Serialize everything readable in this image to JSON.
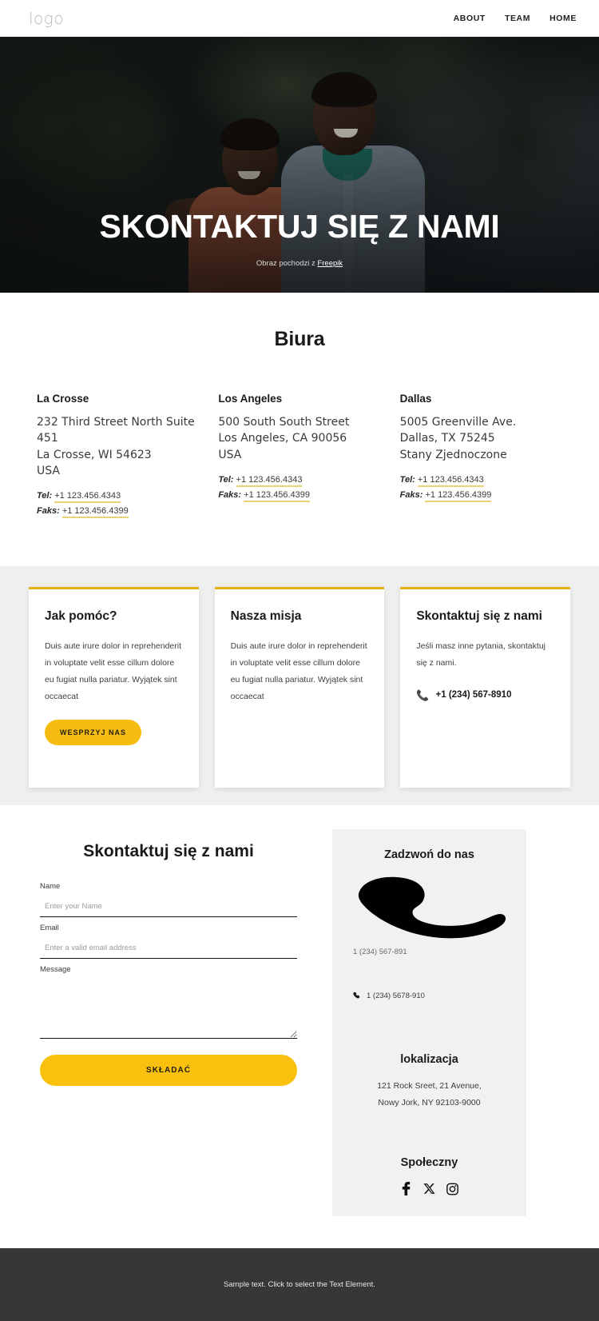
{
  "header": {
    "logo": "logo",
    "nav": [
      {
        "label": "ABOUT"
      },
      {
        "label": "TEAM"
      },
      {
        "label": "HOME"
      }
    ]
  },
  "hero": {
    "title": "SKONTAKTUJ SIĘ Z NAMI",
    "credit_prefix": "Obraz pochodzi z ",
    "credit_link": "Freepik"
  },
  "offices": {
    "heading": "Biura",
    "tel_label": "Tel:",
    "fax_label": "Faks:",
    "items": [
      {
        "city": "La Crosse",
        "address": "232 Third Street North Suite 451\nLa Crosse, WI 54623\nUSA",
        "tel": "+1 123.456.4343",
        "fax": "+1 123.456.4399"
      },
      {
        "city": "Los Angeles",
        "address": "500 South South Street\nLos Angeles, CA 90056\nUSA",
        "tel": "+1 123.456.4343",
        "fax": "+1 123.456.4399"
      },
      {
        "city": "Dallas",
        "address": "5005 Greenville Ave.\nDallas, TX 75245\nStany Zjednoczone",
        "tel": "+1 123.456.4343",
        "fax": "+1 123.456.4399"
      }
    ]
  },
  "cards": [
    {
      "title": "Jak pomóc?",
      "body": "Duis aute irure dolor in reprehenderit in voluptate velit esse cillum dolore eu fugiat nulla pariatur. Wyjątek sint occaecat",
      "button": "WESPRZYJ NAS"
    },
    {
      "title": "Nasza misja",
      "body": "Duis aute irure dolor in reprehenderit in voluptate velit esse cillum dolore eu fugiat nulla pariatur. Wyjątek sint occaecat"
    },
    {
      "title": "Skontaktuj się z nami",
      "body": "Jeśli masz inne pytania, skontaktuj się z nami.",
      "phone": "+1 (234) 567-8910"
    }
  ],
  "contact_form": {
    "heading": "Skontaktuj się z nami",
    "name_label": "Name",
    "name_placeholder": "Enter your Name",
    "name_value": "",
    "email_label": "Email",
    "email_placeholder": "Enter a valid email address",
    "email_value": "",
    "message_label": "Message",
    "message_placeholder": "",
    "message_value": "",
    "submit_label": "SKŁADAĆ"
  },
  "side_panel": {
    "call_heading": "Zadzwoń do nas",
    "phone_primary": "1 (234) 567-891",
    "phone_secondary": "1 (234) 5678-910",
    "location_heading": "lokalizacja",
    "location_line1": "121 Rock Sreet, 21 Avenue,",
    "location_line2": "Nowy Jork, NY 92103-9000",
    "social_heading": "Społeczny",
    "social": [
      {
        "name": "facebook-icon"
      },
      {
        "name": "x-twitter-icon"
      },
      {
        "name": "instagram-icon"
      }
    ]
  },
  "footer": {
    "text": "Sample text. Click to select the Text Element."
  },
  "colors": {
    "accent_yellow": "#f6bd10",
    "card_top_border": "#e3b219",
    "underline_yellow": "#e8d477",
    "section_gray": "#efefef",
    "panel_gray": "#f1f1f1",
    "footer_dark": "#373737"
  }
}
